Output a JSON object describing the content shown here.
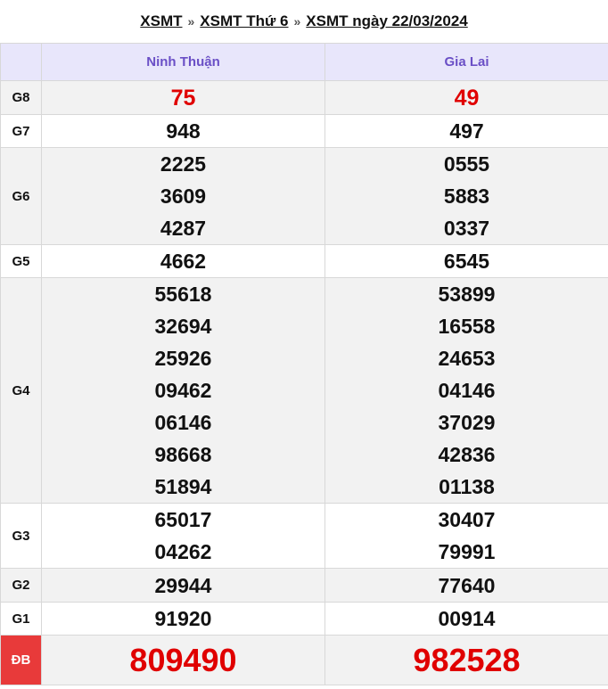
{
  "breadcrumb": {
    "item1": "XSMT",
    "sep": "»",
    "item2": "XSMT Thứ 6",
    "item3": "XSMT ngày 22/03/2024"
  },
  "provinces": [
    "Ninh Thuận",
    "Gia Lai"
  ],
  "prizes": {
    "g8": {
      "label": "G8",
      "values": [
        [
          "75"
        ],
        [
          "49"
        ]
      ]
    },
    "g7": {
      "label": "G7",
      "values": [
        [
          "948"
        ],
        [
          "497"
        ]
      ]
    },
    "g6": {
      "label": "G6",
      "values": [
        [
          "2225",
          "3609",
          "4287"
        ],
        [
          "0555",
          "5883",
          "0337"
        ]
      ]
    },
    "g5": {
      "label": "G5",
      "values": [
        [
          "4662"
        ],
        [
          "6545"
        ]
      ]
    },
    "g4": {
      "label": "G4",
      "values": [
        [
          "55618",
          "32694",
          "25926",
          "09462",
          "06146",
          "98668",
          "51894"
        ],
        [
          "53899",
          "16558",
          "24653",
          "04146",
          "37029",
          "42836",
          "01138"
        ]
      ]
    },
    "g3": {
      "label": "G3",
      "values": [
        [
          "65017",
          "04262"
        ],
        [
          "30407",
          "79991"
        ]
      ]
    },
    "g2": {
      "label": "G2",
      "values": [
        [
          "29944"
        ],
        [
          "77640"
        ]
      ]
    },
    "g1": {
      "label": "G1",
      "values": [
        [
          "91920"
        ],
        [
          "00914"
        ]
      ]
    },
    "db": {
      "label": "ĐB",
      "values": [
        [
          "809490"
        ],
        [
          "982528"
        ]
      ]
    }
  },
  "colors": {
    "header_bg": "#e8e6fb",
    "header_text": "#6a4fc6",
    "highlight_red": "#e00000",
    "db_label_bg": "#e83a3a",
    "alt_row_bg": "#f2f2f2"
  }
}
